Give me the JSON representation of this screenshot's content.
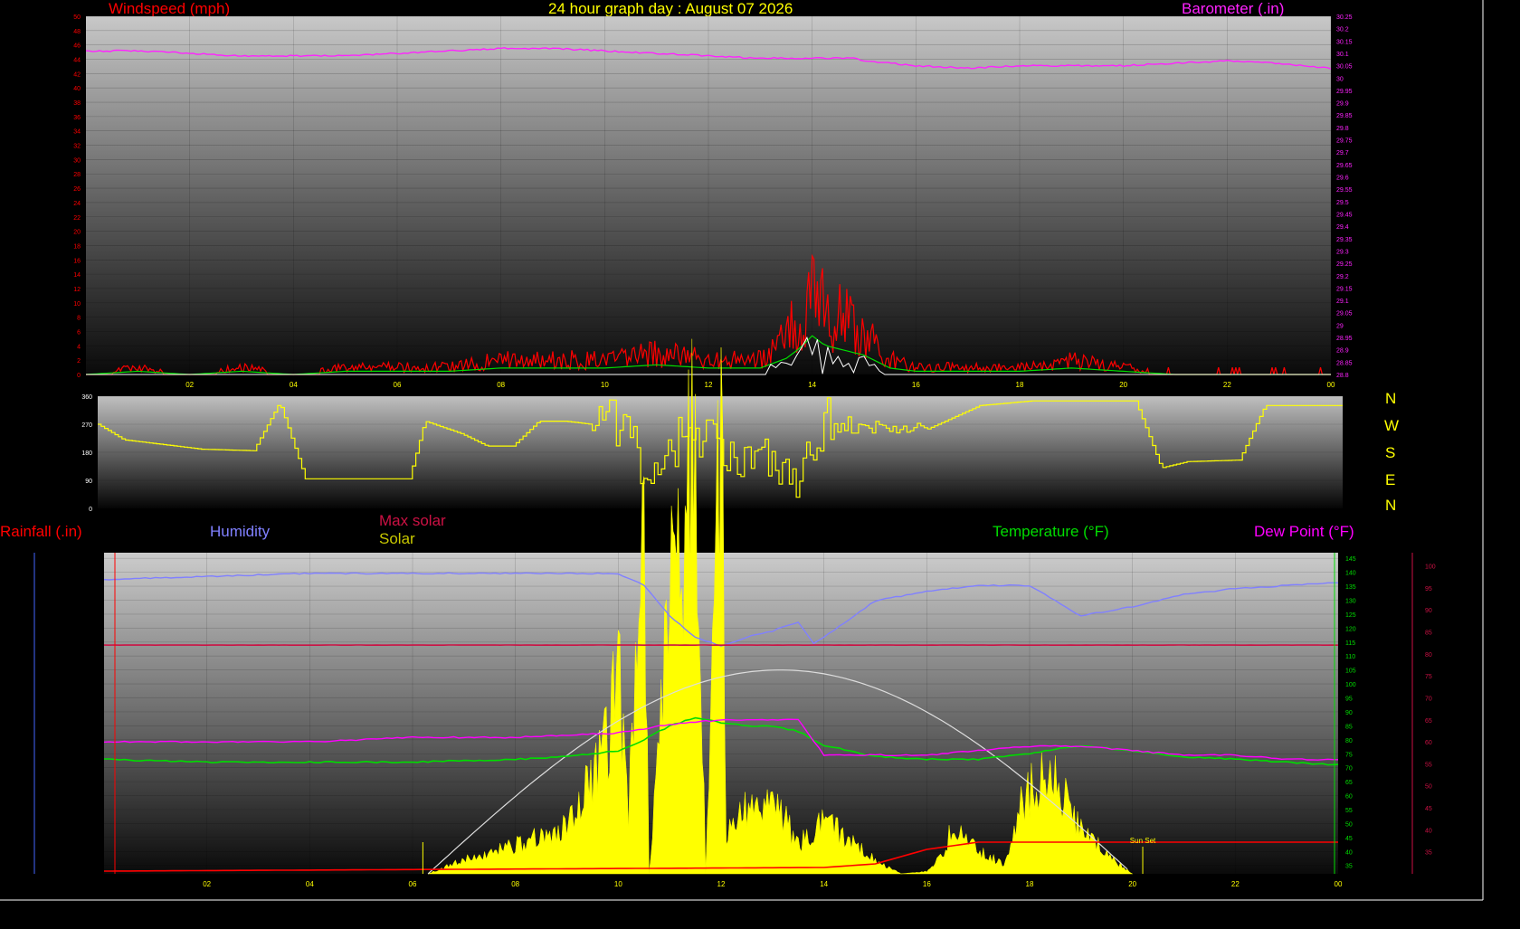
{
  "header": {
    "title": "24 hour graph day : August 07 2026",
    "windspeed_label": "Windspeed (mph)",
    "barometer_label": "Barometer (.in)",
    "rainfall_label": "Rainfall (.in)",
    "humidity_label": "Humidity",
    "max_solar_label": "Max solar",
    "solar_label": "Solar",
    "temperature_label": "Temperature (°F)",
    "dewpoint_label": "Dew Point (°F)",
    "sunset_label": "Sun Set",
    "compass": [
      "N",
      "W",
      "S",
      "E",
      "N"
    ]
  },
  "colors": {
    "windspeed": "#ff0000",
    "barometer": "#ff22ff",
    "title": "#ffff00",
    "direction": "#ffff00",
    "humidity": "#8080ff",
    "max_solar": "#cc1144",
    "solar": "#ffff00",
    "temperature": "#00dd00",
    "dewpoint": "#ff00ff",
    "rain": "#ff0000",
    "solar_curve": "#dddddd"
  },
  "chart_data": [
    {
      "type": "line",
      "title": "24 hour graph day : August 07 2026",
      "xlabel": "",
      "x_ticks": [
        "02",
        "04",
        "06",
        "08",
        "10",
        "12",
        "14",
        "16",
        "18",
        "20",
        "22",
        "00"
      ],
      "y_left_ticks": [
        "0",
        "2",
        "4",
        "6",
        "8",
        "10",
        "12",
        "14",
        "16",
        "18",
        "20",
        "22",
        "24",
        "26",
        "28",
        "30",
        "32",
        "34",
        "36",
        "38",
        "40",
        "42",
        "44",
        "46",
        "48",
        "50"
      ],
      "y_right_ticks": [
        "28.8",
        "28.85",
        "28.9",
        "28.95",
        "29",
        "29.05",
        "29.1",
        "29.15",
        "29.2",
        "29.25",
        "29.3",
        "29.35",
        "29.4",
        "29.45",
        "29.5",
        "29.55",
        "29.6",
        "29.65",
        "29.7",
        "29.75",
        "29.8",
        "29.85",
        "29.9",
        "29.95",
        "30",
        "30.05",
        "30.1",
        "30.15",
        "30.2",
        "30.25"
      ],
      "ylim_left": [
        0,
        50
      ],
      "ylim_right": [
        28.8,
        30.25
      ],
      "series": [
        {
          "name": "Windspeed (mph)",
          "axis": "left",
          "color": "#ff0000",
          "x": [
            0,
            1,
            2,
            3,
            4,
            5,
            6,
            7,
            8,
            9,
            10,
            11,
            12,
            13,
            13.5,
            13.75,
            14,
            14.25,
            14.5,
            14.75,
            15,
            15.5,
            16,
            17,
            18,
            19,
            20,
            21,
            22,
            23,
            24
          ],
          "y": [
            0,
            1,
            0,
            1,
            0,
            1,
            1,
            1,
            2,
            2,
            2,
            3,
            2,
            2,
            5,
            8,
            12,
            9,
            8,
            7,
            6,
            2,
            1,
            1,
            1,
            2,
            1,
            0,
            0,
            0,
            0
          ]
        },
        {
          "name": "Barometer (.in)",
          "axis": "right",
          "color": "#ff22ff",
          "x": [
            0,
            1,
            2,
            3,
            4,
            5,
            6,
            7,
            8,
            9,
            10,
            11,
            12,
            13,
            14,
            14.8,
            15,
            16,
            17,
            18,
            19,
            20,
            21,
            22,
            23,
            24
          ],
          "y": [
            30.11,
            30.11,
            30.1,
            30.09,
            30.09,
            30.09,
            30.1,
            30.11,
            30.12,
            30.12,
            30.11,
            30.1,
            30.09,
            30.08,
            30.08,
            30.08,
            30.07,
            30.05,
            30.04,
            30.05,
            30.05,
            30.05,
            30.06,
            30.07,
            30.06,
            30.04
          ]
        }
      ]
    },
    {
      "type": "line",
      "title": "",
      "x_ticks": [
        "02",
        "04",
        "06",
        "08",
        "10",
        "12",
        "14",
        "16",
        "18",
        "20",
        "22",
        "00"
      ],
      "y_ticks": [
        "0",
        "90",
        "180",
        "270",
        "360"
      ],
      "ylim": [
        0,
        360
      ],
      "series": [
        {
          "name": "",
          "color": "#ffff00",
          "x": [
            0,
            0.5,
            1,
            2,
            3,
            3.5,
            4,
            5,
            6,
            6.3,
            7,
            7.5,
            8,
            8.5,
            9,
            9.5,
            10,
            10.5,
            11,
            11.5,
            12,
            12.5,
            13,
            13.5,
            14,
            14.5,
            15,
            16,
            17,
            18,
            19,
            20,
            20.5,
            21,
            22,
            22.5,
            23,
            24
          ],
          "y": [
            270,
            220,
            210,
            190,
            185,
            340,
            95,
            95,
            95,
            280,
            240,
            200,
            200,
            280,
            280,
            270,
            270,
            140,
            200,
            250,
            180,
            130,
            190,
            70,
            280,
            260,
            260,
            255,
            330,
            345,
            345,
            345,
            130,
            150,
            155,
            330,
            330,
            330
          ]
        }
      ]
    },
    {
      "type": "area",
      "title": "",
      "x_ticks": [
        "02",
        "04",
        "06",
        "08",
        "10",
        "12",
        "14",
        "16",
        "18",
        "20",
        "22",
        "00"
      ],
      "y_right_ticks": [
        "35",
        "40",
        "45",
        "50",
        "55",
        "60",
        "65",
        "70",
        "75",
        "80",
        "85",
        "90",
        "95",
        "100",
        "105",
        "110",
        "115",
        "120",
        "125",
        "130",
        "135",
        "140",
        "145"
      ],
      "y_dew_ticks": [
        "35",
        "40",
        "45",
        "50",
        "55",
        "60",
        "65",
        "70",
        "75",
        "80",
        "85",
        "90",
        "95",
        "100"
      ],
      "ylim_temp": [
        32,
        147
      ],
      "ylim_dew": [
        30,
        103
      ],
      "series": [
        {
          "name": "Humidity",
          "color": "#8080ff",
          "x": [
            0,
            2,
            4,
            6,
            8,
            10,
            10.5,
            11,
            11.5,
            12,
            12.5,
            13,
            13.5,
            13.8,
            14,
            15,
            16,
            17,
            18,
            18.5,
            19,
            20,
            21,
            22,
            23,
            24
          ],
          "y": [
            97,
            98,
            99,
            99,
            99,
            99,
            95,
            85,
            78,
            75,
            78,
            80,
            83,
            76,
            78,
            90,
            93,
            95,
            95,
            90,
            85,
            88,
            92,
            94,
            95,
            96
          ]
        },
        {
          "name": "Temperature (°F)",
          "color": "#00dd00",
          "x": [
            0,
            2,
            4,
            6,
            8,
            9,
            10,
            10.5,
            11,
            11.5,
            12,
            12.5,
            13,
            13.5,
            14,
            15,
            16,
            17,
            18,
            19,
            20,
            21,
            22,
            23,
            24
          ],
          "y": [
            73,
            72,
            72,
            72,
            73,
            74,
            76,
            80,
            85,
            88,
            86,
            85,
            85,
            83,
            78,
            74,
            73,
            73,
            75,
            78,
            76,
            74,
            73,
            72,
            71
          ]
        },
        {
          "name": "Dew Point (°F)",
          "color": "#ff00ff",
          "x": [
            0,
            2,
            4,
            6,
            8,
            10,
            10.5,
            11,
            12,
            13,
            13.5,
            14,
            15,
            16,
            17,
            18,
            19,
            20,
            21,
            22,
            23,
            24
          ],
          "y": [
            60,
            60,
            60,
            61,
            61,
            62,
            63,
            64,
            65,
            65,
            65,
            57,
            57,
            57,
            58,
            59,
            59,
            58,
            57,
            57,
            56,
            56
          ]
        },
        {
          "name": "Max solar",
          "color": "#cc1144",
          "x": [
            0,
            4,
            8,
            12,
            16,
            20,
            24
          ],
          "y": [
            82,
            82,
            82,
            82,
            82,
            82,
            82
          ]
        },
        {
          "name": "Solar",
          "color": "#ffff00",
          "x": [
            6.3,
            7,
            8,
            9,
            9.5,
            9.8,
            10,
            10.2,
            10.5,
            10.6,
            11,
            11.2,
            11.5,
            11.7,
            12,
            12.1,
            12.5,
            13,
            13.5,
            14,
            15,
            15.5,
            16,
            16.3,
            16.5,
            17,
            17.5,
            17.8,
            18,
            18.3,
            18.5,
            19,
            19.5,
            20
          ],
          "y": [
            32,
            38,
            44,
            52,
            75,
            90,
            120,
            60,
            175,
            30,
            160,
            160,
            230,
            30,
            240,
            50,
            60,
            65,
            45,
            55,
            38,
            32,
            33,
            40,
            52,
            42,
            36,
            60,
            68,
            75,
            72,
            52,
            40,
            32
          ]
        },
        {
          "name": "Rainfall (.in)",
          "color": "#ff0000",
          "x": [
            0,
            14,
            15,
            15.5,
            16,
            17,
            18,
            19,
            20,
            21,
            22,
            23,
            24
          ],
          "y": [
            0,
            0.01,
            0.02,
            0.04,
            0.06,
            0.08,
            0.08,
            0.08,
            0.08,
            0.08,
            0.08,
            0.08,
            0.08
          ]
        }
      ]
    }
  ]
}
